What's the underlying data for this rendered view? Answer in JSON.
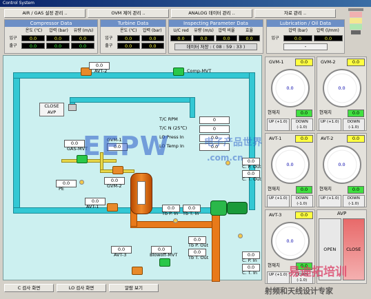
{
  "window": {
    "title": "Control System"
  },
  "top_menu": [
    "AIR / GAS 설정 관리 ..",
    "OVM 제어 관리 ..",
    "ANALOG 데이터 관리 ..",
    "자료 관리 .."
  ],
  "compressor": {
    "title": "Compressor Data",
    "headers": [
      "온도 (℃)",
      "압력 (bar)",
      "유량 (m/s)"
    ],
    "rows": [
      {
        "label": "입구",
        "values": [
          "0.0",
          "0.0",
          "0.0"
        ]
      },
      {
        "label": "출구",
        "values": [
          "0.0",
          "0.0",
          "0.0"
        ]
      }
    ]
  },
  "turbine": {
    "title": "Turbine Data",
    "headers": [
      "온도 (℃)",
      "압력 (bar)"
    ],
    "rows": [
      {
        "label": "입구",
        "values": [
          "0.0",
          "0.0"
        ]
      },
      {
        "label": "출구",
        "values": [
          "0.0",
          "0.0"
        ]
      }
    ]
  },
  "inspecting": {
    "title": "Inspecting Parameter Data",
    "headers": [
      "U/C red",
      "유량 (m/s)",
      "압력 비율",
      "효율"
    ],
    "values": [
      "0.0",
      "0.0",
      "0.0",
      "0.0"
    ],
    "timestamp": "데이터 저장 : ( 08 : 59 : 33 )"
  },
  "lubrication": {
    "title": "Lubrication / Oil Data",
    "headers": [
      "압력 (bar)",
      "압력 (l/mm)"
    ],
    "row_label": "입구",
    "values": [
      "0.0",
      "0.0"
    ],
    "extra": "-"
  },
  "diagram": {
    "avt2": {
      "value": "0.0",
      "name": "AVT-2"
    },
    "comp_mvt": "Comp-MVT",
    "avp_box": {
      "state": "CLOSE",
      "name": "AVP"
    },
    "gas_mvt": {
      "value": "0.0",
      "name": "GAS-MVT"
    },
    "gvm1": {
      "name": "GVM-1",
      "value": "0.0"
    },
    "gvm2": {
      "value": "0.0",
      "name": "GVM-2"
    },
    "pe": {
      "value": "0.0",
      "name": "PE"
    },
    "avt1": {
      "value": "0.0",
      "name": "AVT-1"
    },
    "avt3": {
      "value": "0.0",
      "name": "AVT-3"
    },
    "blowoff": {
      "value": "0.0",
      "name": "Blowoff-MVT"
    },
    "readouts": [
      {
        "label": "T/C RPM",
        "value": "0"
      },
      {
        "label": "T/C N (25℃)",
        "value": "0"
      },
      {
        "label": "LO Press In",
        "value": "0.0"
      },
      {
        "label": "LO Temp In",
        "value": "0.0"
      }
    ],
    "cp_out": {
      "value": "0.0",
      "name": "C. P. Out"
    },
    "ct_out": {
      "value": "0.0",
      "name": "C. T. Out"
    },
    "tbp_in": {
      "value": "0.0",
      "name": "Tb P. In"
    },
    "tbt_in": {
      "value": "0.0",
      "name": "Tb T. In"
    },
    "tbp_out": {
      "value": "0.0",
      "name": "Tb P. Out"
    },
    "tbt_out": {
      "value": "0.0",
      "name": "Tb T. Out"
    },
    "cp_in": {
      "value": "0.0",
      "name": "C. P. In"
    },
    "ct_in": {
      "value": "0.0",
      "name": "C. T. In"
    }
  },
  "gauges": [
    {
      "name": "GVM-1",
      "value": "0.0",
      "dial": "0.0",
      "current_label": "현재치",
      "current": "0.0",
      "up": "UP (+1.0)",
      "down": "DOWN (-1.0)"
    },
    {
      "name": "GVM-2",
      "value": "0.0",
      "dial": "0.0",
      "current_label": "현재치",
      "current": "0.0",
      "up": "UP (+1.0)",
      "down": "DOWN (-1.0)"
    },
    {
      "name": "AVT-1",
      "value": "0.0",
      "dial": "0.0",
      "current_label": "현재치",
      "current": "0.0",
      "up": "UP (+1.0)",
      "down": "DOWN (-1.0)"
    },
    {
      "name": "AVT-2",
      "value": "0.0",
      "dial": "0.0",
      "current_label": "현재치",
      "current": "0.0",
      "up": "UP (+1.0)",
      "down": "DOWN (-1.0)"
    },
    {
      "name": "AVT-3",
      "value": "0.0",
      "dial": "0.0",
      "current_label": "현재치",
      "current": "0.0",
      "up": "UP (+1.0)",
      "down": "DOWN (-1.0)"
    }
  ],
  "avp_panel": {
    "title": "AVP",
    "open": "OPEN",
    "close": "CLOSE"
  },
  "bottom_buttons": [
    "C 검사 화면",
    "LO 검사 화면",
    "알람 보기"
  ],
  "watermarks": {
    "eepw": "EEPW",
    "eepw_cn": "电子产品世界",
    "eepw_com": ".com.cn",
    "rf1": "易迪拓培训",
    "rf2": "射频和天线设计专家"
  }
}
